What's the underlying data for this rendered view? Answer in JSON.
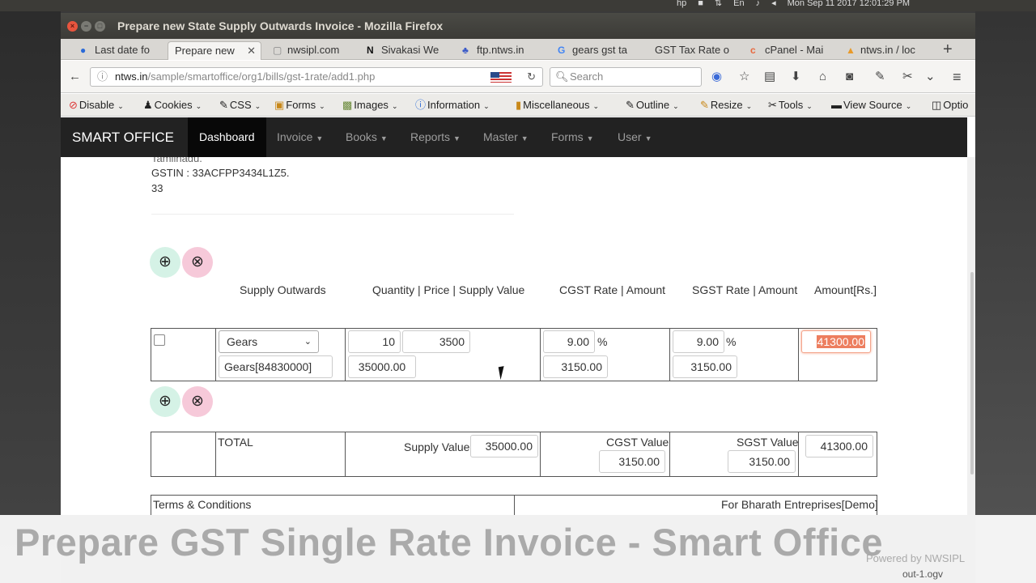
{
  "system": {
    "clock": "Mon Sep 11 2017 12:01:29 PM"
  },
  "window": {
    "title": "Prepare new State Supply Outwards Invoice - Mozilla Firefox",
    "close": "×",
    "min": "−",
    "max": "□"
  },
  "tabs": [
    {
      "label": "Last date fo",
      "icon": "firefox-icon"
    },
    {
      "label": "Prepare new",
      "icon": "",
      "active": true
    },
    {
      "label": "nwsipl.com",
      "icon": "page-icon"
    },
    {
      "label": "Sivakasi We",
      "icon": "n-icon"
    },
    {
      "label": "ftp.ntws.in",
      "icon": "ftp-icon"
    },
    {
      "label": "gears gst ta",
      "icon": "google-icon"
    },
    {
      "label": "GST Tax Rate o",
      "icon": ""
    },
    {
      "label": "cPanel - Mai",
      "icon": "cpanel-icon"
    },
    {
      "label": "ntws.in / loc",
      "icon": "pma-icon"
    }
  ],
  "nav": {
    "url_host": "ntws.in",
    "url_path": "/sample/smartoffice/org1/bills/gst-1rate/add1.php",
    "search_placeholder": "Search"
  },
  "devtools": [
    "Disable",
    "Cookies",
    "CSS",
    "Forms",
    "Images",
    "Information",
    "Miscellaneous",
    "Outline",
    "Resize",
    "Tools",
    "View Source",
    "Optio"
  ],
  "app": {
    "brand": "SMART OFFICE",
    "menu": [
      "Dashboard",
      "Invoice",
      "Books",
      "Reports",
      "Master",
      "Forms",
      "User"
    ]
  },
  "party": {
    "state": "Tamilnadu.",
    "gstin": "GSTIN : 33ACFPP3434L1Z5.",
    "state_code": "33"
  },
  "headers": {
    "supply": "Supply Outwards",
    "qty": "Quantity | Price | Supply Value",
    "cgst": "CGST Rate | Amount",
    "sgst": "SGST Rate | Amount",
    "amount": "Amount[Rs.]"
  },
  "item": {
    "product": "Gears",
    "product_code": "Gears[84830000]",
    "quantity": "10",
    "price": "3500",
    "supply_value": "35000.00",
    "cgst_rate": "9.00",
    "cgst_amount": "3150.00",
    "sgst_rate": "9.00",
    "sgst_amount": "3150.00",
    "pct": "%",
    "amount": "41300.00"
  },
  "totals": {
    "label": "TOTAL",
    "supply_label": "Supply Value",
    "supply_value": "35000.00",
    "cgst_label": "CGST Value",
    "cgst_value": "3150.00",
    "sgst_label": "SGST Value",
    "sgst_value": "3150.00",
    "grand_total": "41300.00"
  },
  "footer": {
    "terms": "Terms & Conditions",
    "for": "For Bharath Entreprises[Demo]"
  },
  "caption": {
    "text": "Prepare GST Single Rate Invoice - Smart Office",
    "powered": "Powered by NWSIPL",
    "file": "out-1.ogv"
  },
  "buttons": {
    "add": "⊕",
    "remove": "⊗"
  }
}
